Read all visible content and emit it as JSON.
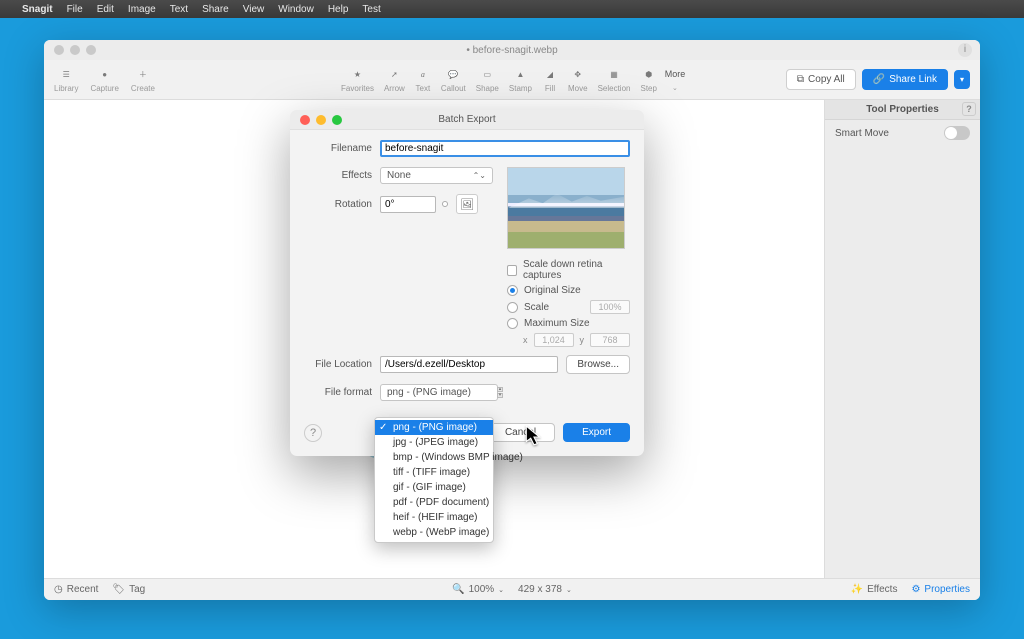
{
  "menubar": {
    "app": "Snagit",
    "items": [
      "File",
      "Edit",
      "Image",
      "Text",
      "Share",
      "View",
      "Window",
      "Help",
      "Test"
    ]
  },
  "window": {
    "title": "• before-snagit.webp",
    "toolbar_left": [
      {
        "name": "library",
        "label": "Library"
      },
      {
        "name": "capture",
        "label": "Capture"
      },
      {
        "name": "create",
        "label": "Create"
      }
    ],
    "toolbar_center": [
      {
        "name": "favorites",
        "label": "Favorites"
      },
      {
        "name": "arrow",
        "label": "Arrow"
      },
      {
        "name": "text",
        "label": "Text"
      },
      {
        "name": "callout",
        "label": "Callout"
      },
      {
        "name": "shape",
        "label": "Shape"
      },
      {
        "name": "stamp",
        "label": "Stamp"
      },
      {
        "name": "fill",
        "label": "Fill"
      },
      {
        "name": "move",
        "label": "Move"
      },
      {
        "name": "selection",
        "label": "Selection"
      },
      {
        "name": "step",
        "label": "Step"
      }
    ],
    "more_label": "More",
    "copy_all": "Copy All",
    "share_link": "Share Link",
    "side_title": "Tool Properties",
    "smart_move": "Smart Move"
  },
  "status": {
    "recent": "Recent",
    "tag": "Tag",
    "zoom": "100%",
    "dims": "429 x 378",
    "effects": "Effects",
    "properties": "Properties"
  },
  "modal": {
    "title": "Batch Export",
    "filename_label": "Filename",
    "filename_value": "before-snagit",
    "effects_label": "Effects",
    "effects_value": "None",
    "rotation_label": "Rotation",
    "rotation_value": "0°",
    "scaledown": "Scale down retina captures",
    "orig_size": "Original Size",
    "scale": "Scale",
    "scale_pct": "100%",
    "max_size": "Maximum Size",
    "x_label": "x",
    "x_val": "1,024",
    "y_label": "y",
    "y_val": "768",
    "file_loc_label": "File Location",
    "file_loc_value": "/Users/d.ezell/Desktop",
    "browse": "Browse...",
    "file_fmt_label": "File format",
    "cancel": "Cancel",
    "export": "Export"
  },
  "dropdown": {
    "selected_index": 0,
    "options": [
      "png - (PNG image)",
      "jpg - (JPEG image)",
      "bmp - (Windows BMP image)",
      "tiff - (TIFF image)",
      "gif - (GIF image)",
      "pdf - (PDF document)",
      "heif - (HEIF image)",
      "webp - (WebP image)"
    ]
  }
}
